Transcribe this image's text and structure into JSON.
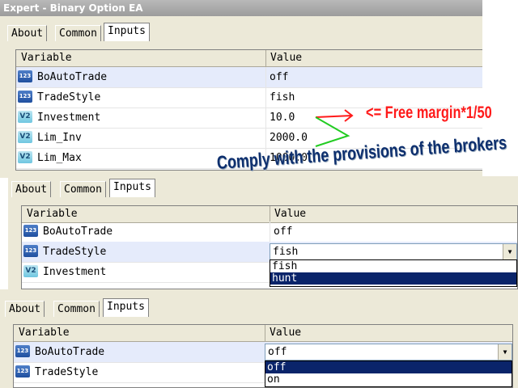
{
  "window": {
    "title": "Expert - Binary Option EA"
  },
  "tabs": [
    "About",
    "Common",
    "Inputs"
  ],
  "columns": {
    "variable": "Variable",
    "value": "Value"
  },
  "panel1": {
    "rows": [
      {
        "name": "BoAutoTrade",
        "value": "off",
        "icon": "123"
      },
      {
        "name": "TradeStyle",
        "value": "fish",
        "icon": "123"
      },
      {
        "name": "Investment",
        "value": "10.0",
        "icon": "V2"
      },
      {
        "name": "Lim_Inv",
        "value": "2000.0",
        "icon": "V2"
      },
      {
        "name": "Lim_Max",
        "value": "1000.0",
        "icon": "V2"
      }
    ]
  },
  "panel2": {
    "rows": [
      {
        "name": "BoAutoTrade",
        "value": "off",
        "icon": "123"
      },
      {
        "name": "TradeStyle",
        "value": "fish",
        "icon": "123"
      },
      {
        "name": "Investment",
        "value": "",
        "icon": "V2"
      }
    ],
    "dropdown_options": [
      "fish",
      "hunt"
    ]
  },
  "panel3": {
    "rows": [
      {
        "name": "BoAutoTrade",
        "value": "off",
        "icon": "123"
      },
      {
        "name": "TradeStyle",
        "value": "",
        "icon": "123"
      }
    ],
    "dropdown_options": [
      "off",
      "on"
    ]
  },
  "annotations": {
    "free_margin": "<= Free margin*1/50",
    "comply": "Comply with the provisions of the brokers"
  },
  "colors": {
    "red_arrow": "#ff1a1a",
    "green_arrow": "#22cc22",
    "selection": "#0a246a"
  },
  "icons": {
    "int": "integer-param-icon",
    "dbl": "double-param-icon",
    "dropdown": "dropdown-arrow-icon"
  }
}
